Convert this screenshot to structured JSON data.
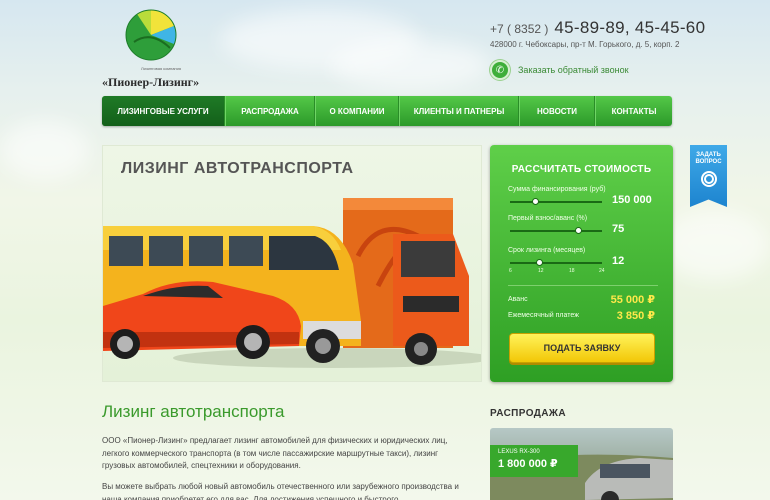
{
  "header": {
    "logo_small": "Лизинговая компания",
    "logo_name": "«Пионер-Лизинг»",
    "phone_code": "+7 ( 8352 )",
    "phone_numbers": "45-89-89, 45-45-60",
    "address": "428000 г. Чебоксары, пр-т М. Горького, д. 5, корп. 2",
    "callback_label": "Заказать обратный звонок"
  },
  "nav": {
    "items": [
      {
        "label": "ЛИЗИНГОВЫЕ УСЛУГИ"
      },
      {
        "label": "РАСПРОДАЖА"
      },
      {
        "label": "О КОМПАНИИ"
      },
      {
        "label": "КЛИЕНТЫ И ПАТНЕРЫ"
      },
      {
        "label": "НОВОСТИ"
      },
      {
        "label": "КОНТАКТЫ"
      }
    ]
  },
  "hero": {
    "title": "ЛИЗИНГ АВТОТРАНСПОРТА"
  },
  "calculator": {
    "title": "РАССЧИТАТЬ СТОИМОСТЬ",
    "sum_label": "Сумма финансирования (руб)",
    "sum_value": "150 000",
    "sum_fraction": 0.28,
    "advance_label": "Первый взнос/аванс (%)",
    "advance_value": "75",
    "advance_fraction": 0.75,
    "term_label": "Срок лизинга (месяцев)",
    "term_value": "12",
    "term_fraction": 0.33,
    "term_ticks": [
      "6",
      "12",
      "18",
      "24"
    ],
    "advance_result_label": "Аванс",
    "advance_result_value": "55 000 ₽",
    "monthly_label": "Ежемесячный платеж",
    "monthly_value": "3 850 ₽",
    "submit_label": "ПОДАТЬ ЗАЯВКУ"
  },
  "ask": {
    "label_1": "ЗАДАТЬ",
    "label_2": "ВОПРОС"
  },
  "content": {
    "title": "Лизинг автотранспорта",
    "para1": "ООО «Пионер-Лизинг»  предлагает лизинг автомобилей для физических и юридических лиц, легкого коммерческого транспорта (в том числе пассажирские маршрутные  такси), лизинг грузовых автомобилей, спецтехники и оборудования.",
    "para2": "Вы можете выбрать любой новый автомобиль отечественного или зарубежного производства и наша компания приобретет его для вас. Для достижения успешного и быстрого"
  },
  "sale": {
    "title": "РАСПРОДАЖА",
    "item_name": "LEXUS RX-300",
    "item_price": "1 800 000 ₽"
  },
  "colors": {
    "accent": "#3a9a2c",
    "nav": "#2c9a2a",
    "cta": "#f2c707",
    "price": "#ffe84a"
  }
}
